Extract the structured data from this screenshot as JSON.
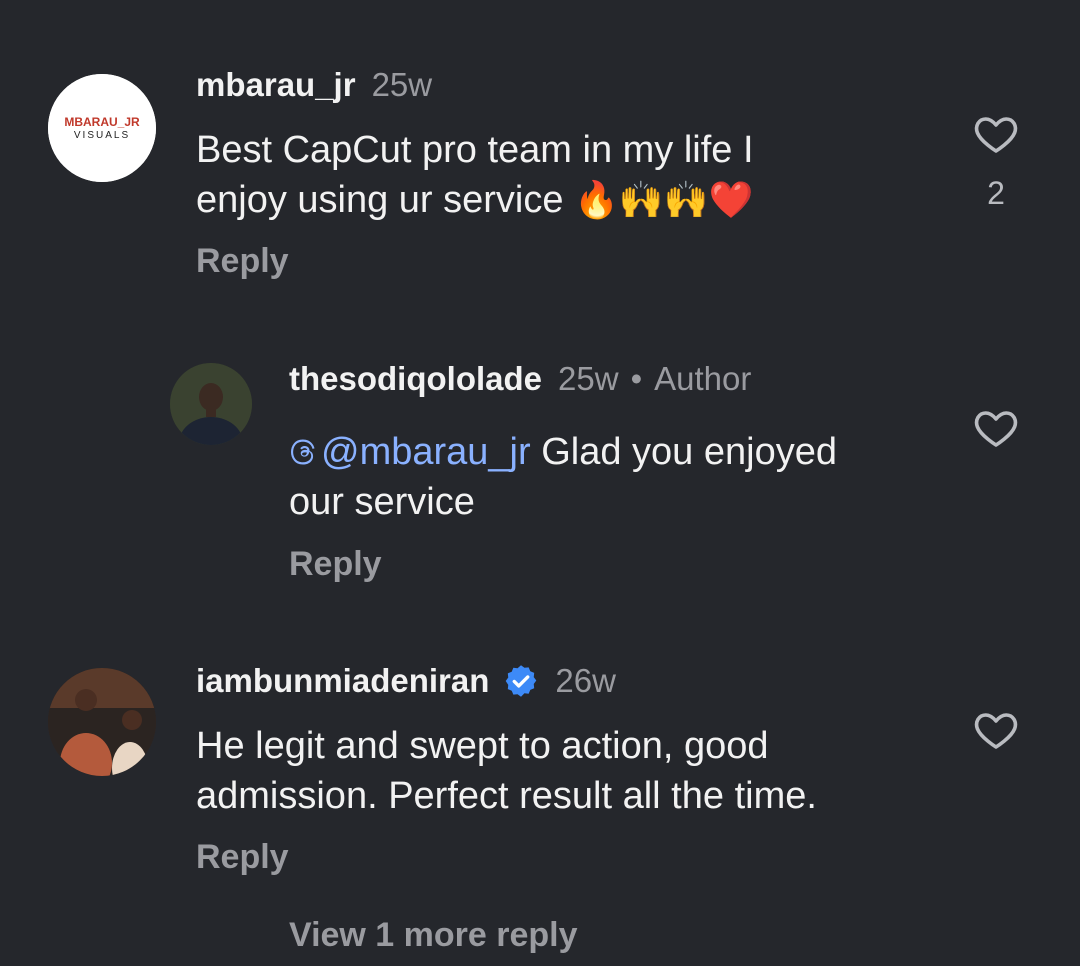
{
  "comments": [
    {
      "avatar_text_top": "MBARAU_JR",
      "avatar_text_bottom": "VISUALS",
      "username": "mbarau_jr",
      "time": "25w",
      "text_line1": "Best CapCut pro team in my life I",
      "text_line2": "enjoy using ur service",
      "emojis": "🔥🙌🙌❤️",
      "reply_label": "Reply",
      "like_count": "2"
    },
    {
      "username": "thesodiqololade",
      "time": "25w",
      "separator": "•",
      "author_label": "Author",
      "mention": "@mbarau_jr",
      "text_line1": " Glad you enjoyed",
      "text_line2": "our service",
      "reply_label": "Reply"
    },
    {
      "username": "iambunmiadeniran",
      "time": "26w",
      "verified": true,
      "text_line1": "He legit and swept to action, good",
      "text_line2": "admission. Perfect result all the time.",
      "reply_label": "Reply"
    }
  ],
  "view_more_label": "View 1 more reply",
  "colors": {
    "background": "#25272c",
    "text": "#f2f2f2",
    "muted": "#9a9ba0",
    "mention": "#8ab1ff",
    "verified": "#3d8af7"
  },
  "icons": {
    "like": "heart-outline-icon",
    "verified": "verified-badge-icon",
    "mention": "threads-at-icon"
  }
}
